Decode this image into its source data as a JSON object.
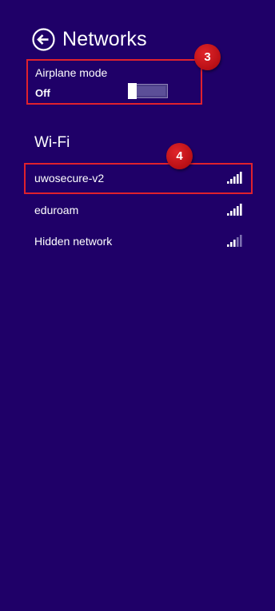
{
  "header": {
    "title": "Networks",
    "back_icon": "back-arrow-circle-icon"
  },
  "airplane_mode": {
    "label": "Airplane mode",
    "state": "Off",
    "on": false
  },
  "wifi": {
    "heading": "Wi-Fi",
    "networks": [
      {
        "name": "uwosecure-v2",
        "signal_bars": 5,
        "signal_icon": "wifi-signal-icon",
        "highlighted": true
      },
      {
        "name": "eduroam",
        "signal_bars": 5,
        "signal_icon": "wifi-signal-icon",
        "highlighted": false
      },
      {
        "name": "Hidden network",
        "signal_bars": 3,
        "signal_icon": "wifi-signal-icon",
        "highlighted": false
      }
    ]
  },
  "badges": {
    "step_3": "3",
    "step_4": "4"
  },
  "colors": {
    "background": "#1f0068",
    "highlight_border": "#e0212d",
    "badge": "#c9161c",
    "text": "#ffffff"
  }
}
